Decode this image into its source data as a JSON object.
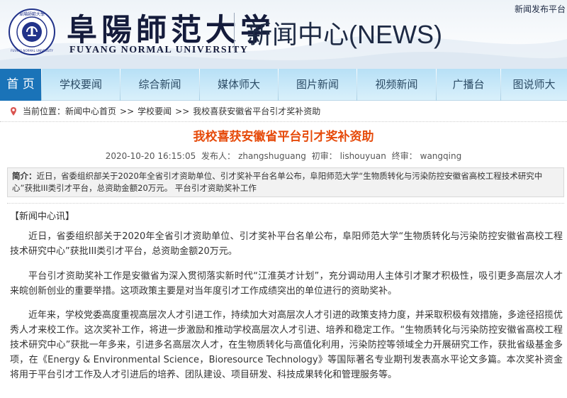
{
  "header": {
    "university_cn": "阜陽師范大学",
    "university_en": "FUYANG NORMAL UNIVERSITY",
    "site_title": "新闻中心(NEWS)",
    "publish_link": "新闻发布平台",
    "seal_text_top": "阜陽師範大學",
    "seal_text_bottom": "FUYANG NORMAL UNIVERSITY",
    "colors": {
      "navy": "#151c3c",
      "seal_blue": "#22338a"
    }
  },
  "nav": {
    "items": [
      {
        "label": "首 页",
        "active": true
      },
      {
        "label": "学校要闻",
        "active": false
      },
      {
        "label": "综合新闻",
        "active": false
      },
      {
        "label": "媒体师大",
        "active": false
      },
      {
        "label": "图片新闻",
        "active": false
      },
      {
        "label": "视频新闻",
        "active": false
      },
      {
        "label": "广播台",
        "active": false
      },
      {
        "label": "图说师大",
        "active": false
      }
    ],
    "colors": {
      "active_bg": "#1a73b8",
      "bar": "#c6e8f8"
    }
  },
  "breadcrumb": {
    "prefix": "当前位置：",
    "items": [
      "新闻中心首页",
      "学校要闻",
      "我校喜获安徽省平台引才奖补资助"
    ],
    "separator": ">>"
  },
  "article": {
    "title": "我校喜获安徽省平台引才奖补资助",
    "title_color": "#e64a0a",
    "date": "2020-10-20 16:15:05",
    "author_label": "发布人：",
    "author": "zhangshuguang",
    "first_review_label": "初审：",
    "first_review": "lishouyuan",
    "final_review_label": "终审：",
    "final_review": "wangqing",
    "summary_label": "简介：",
    "summary_text": "近日，省委组织部关于2020年全省引才资助单位、引才奖补平台名单公布，阜阳师范大学“生物质转化与污染防控安徽省高校工程技术研究中心”获批III类引才平台，总资助金额20万元。 平台引才资助奖补工作",
    "source": "【新闻中心讯】",
    "paragraphs": [
      "近日，省委组织部关于2020年全省引才资助单位、引才奖补平台名单公布，阜阳师范大学“生物质转化与污染防控安徽省高校工程技术研究中心”获批III类引才平台，总资助金额20万元。",
      "平台引才资助奖补工作是安徽省为深入贯彻落实新时代“江淮英才计划”，充分调动用人主体引才聚才积极性，吸引更多高层次人才来皖创新创业的重要举措。这项政策主要是对当年度引才工作成绩突出的单位进行的资助奖补。",
      "近年来，学校党委高度重视高层次人才引进工作，持续加大对高层次人才引进的政策支持力度，并采取积极有效措施，多途径招揽优秀人才来校工作。这次奖补工作，将进一步激励和推动学校高层次人才引进、培养和稳定工作。“生物质转化与污染防控安徽省高校工程技术研究中心”获批一年多来，引进多名高层次人才，在生物质转化与高值化利用，污染防控等领域全力开展研究工作，获批省级基金多项，在《Energy & Environmental Science，Bioresource Technology》等国际著名专业期刊发表高水平论文多篇。本次奖补资金将用于平台引才工作及人才引进后的培养、团队建设、项目研发、科技成果转化和管理服务等。"
    ]
  }
}
